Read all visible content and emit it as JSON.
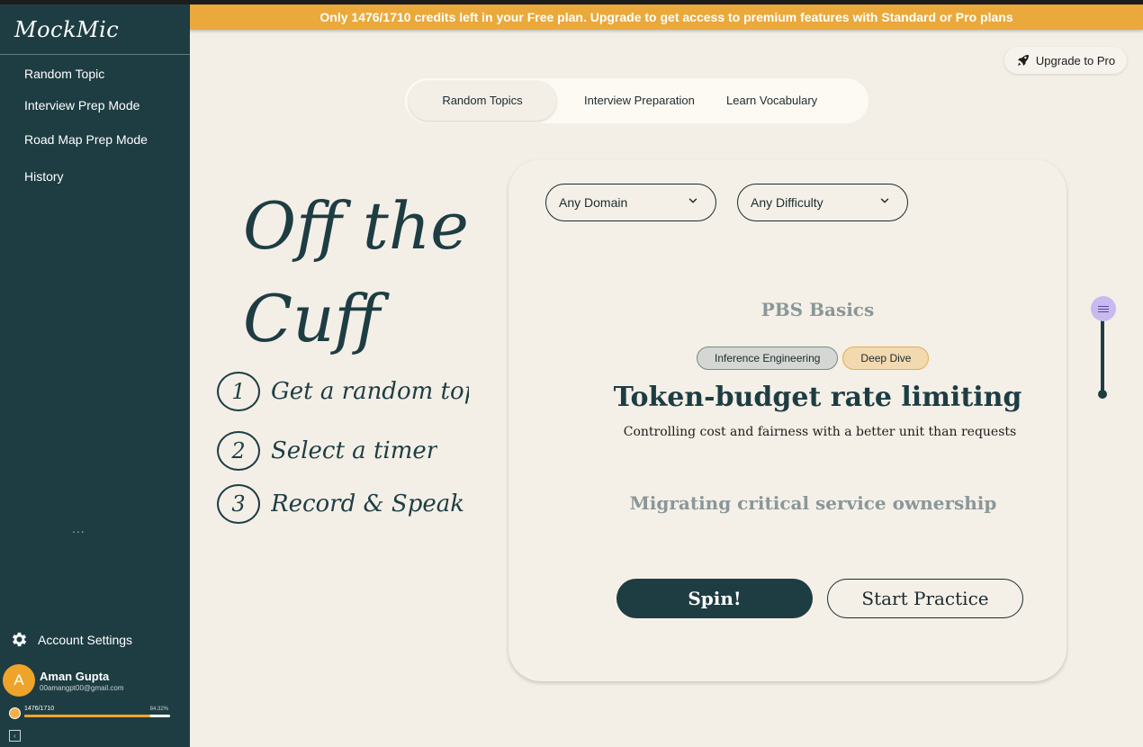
{
  "app": {
    "logo": "MockMic"
  },
  "sidebar": {
    "items": [
      {
        "label": "Random Topic"
      },
      {
        "label": "Interview Prep Mode"
      },
      {
        "label": "Road Map Prep Mode"
      },
      {
        "label": "History"
      }
    ],
    "more": "...",
    "account_settings": "Account Settings",
    "user": {
      "initial": "A",
      "name": "Aman Gupta",
      "email": "00amangpt00@gmail.com"
    },
    "credits": {
      "count": "1476/1710",
      "percent_label": "84.32%",
      "fraction": 0.8632
    }
  },
  "banner": {
    "text": "Only 1476/1710 credits left in your Free plan. Upgrade to get access to premium features with Standard or Pro plans"
  },
  "upgrade_button": {
    "label": "Upgrade to Pro"
  },
  "tabs": [
    {
      "label": "Random Topics",
      "active": true
    },
    {
      "label": "Interview Preparation",
      "active": false
    },
    {
      "label": "Learn Vocabulary",
      "active": false
    }
  ],
  "hero": {
    "title_line1": "Off the",
    "title_line2": "Cuff",
    "steps": [
      {
        "num": "1",
        "text": "Get a random topic"
      },
      {
        "num": "2",
        "text": "Select a timer"
      },
      {
        "num": "3",
        "text": "Record & Speak"
      }
    ]
  },
  "card": {
    "domain_select": "Any Domain",
    "difficulty_select": "Any Difficulty",
    "prev_topic": "PBS Basics",
    "tags": [
      "Inference Engineering",
      "Deep Dive"
    ],
    "topic_title": "Token-budget rate limiting",
    "topic_subtitle": "Controlling cost and fairness with a better unit than requests",
    "next_topic": "Migrating critical service ownership",
    "spin_label": "Spin!",
    "practice_label": "Start Practice"
  },
  "colors": {
    "accent": "#eaa93a",
    "sidebar": "#1e3d43",
    "background": "#f3efe7",
    "slider_handle": "#c8b9ef"
  }
}
